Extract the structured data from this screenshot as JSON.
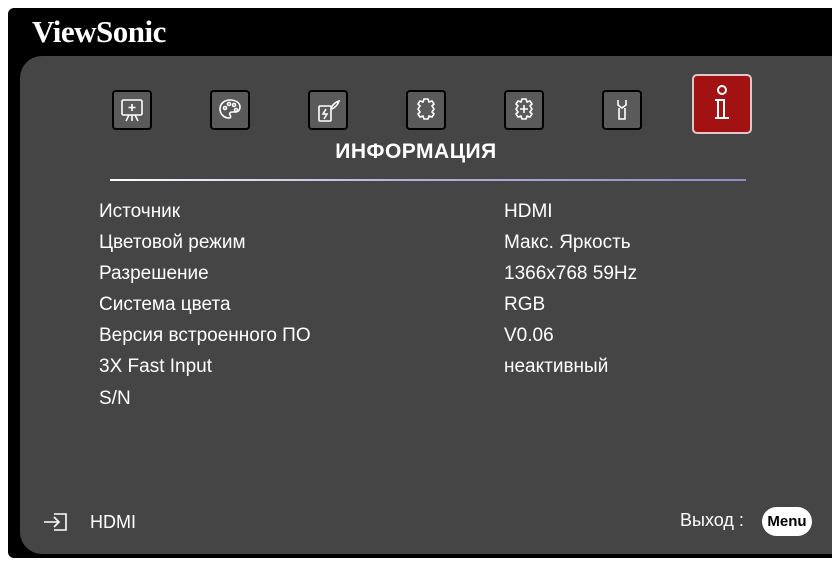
{
  "brand": "ViewSonic",
  "menu_title": "ИНФОРМАЦИЯ",
  "icons": [
    {
      "name": "display-icon"
    },
    {
      "name": "picture-icon"
    },
    {
      "name": "power-icon"
    },
    {
      "name": "basic-settings-icon"
    },
    {
      "name": "advanced-settings-icon"
    },
    {
      "name": "system-icon"
    },
    {
      "name": "information-icon",
      "active": true
    }
  ],
  "info_rows": [
    {
      "label": "Источник",
      "value": "HDMI"
    },
    {
      "label": "Цветовой режим",
      "value": "Макс. Яркость"
    },
    {
      "label": "Разрешение",
      "value": "1366x768 59Hz"
    },
    {
      "label": "Система цвета",
      "value": "RGB"
    },
    {
      "label": "Версия встроенного ПО",
      "value": "V0.06"
    },
    {
      "label": "3X Fast Input",
      "value": "неактивный"
    },
    {
      "label": "S/N",
      "value": ""
    }
  ],
  "footer": {
    "source": "HDMI",
    "exit_label": "Выход :",
    "menu_button": "Menu"
  },
  "colors": {
    "panel": "#454545",
    "active_tab": "#a31212",
    "frame": "#000000"
  }
}
